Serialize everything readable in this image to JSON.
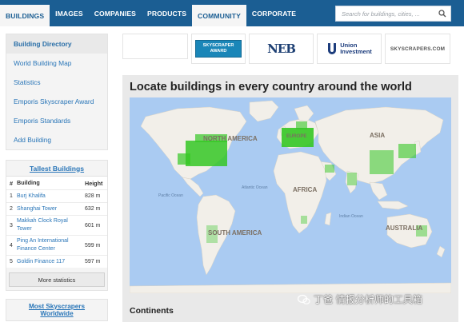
{
  "nav": {
    "items": [
      {
        "label": "BUILDINGS",
        "active": true
      },
      {
        "label": "IMAGES",
        "active": false
      },
      {
        "label": "COMPANIES",
        "active": false
      },
      {
        "label": "PRODUCTS",
        "active": false
      },
      {
        "label": "COMMUNITY",
        "active": true
      },
      {
        "label": "CORPORATE",
        "active": false
      }
    ],
    "search_placeholder": "Search for buildings, cities, ...",
    "search_icon": "search-icon"
  },
  "sidebar": {
    "items": [
      {
        "label": "Building Directory",
        "active": true
      },
      {
        "label": "World Building Map",
        "active": false
      },
      {
        "label": "Statistics",
        "active": false
      },
      {
        "label": "Emporis Skyscraper Award",
        "active": false
      },
      {
        "label": "Emporis Standards",
        "active": false
      },
      {
        "label": "Add Building",
        "active": false
      }
    ]
  },
  "tallest": {
    "title": "Tallest Buildings",
    "headers": {
      "num": "#",
      "building": "Building",
      "height": "Height"
    },
    "rows": [
      {
        "num": "1",
        "building": "Burj Khalifa",
        "height": "828 m"
      },
      {
        "num": "2",
        "building": "Shanghai Tower",
        "height": "632 m"
      },
      {
        "num": "3",
        "building": "Makkah Clock Royal Tower",
        "height": "601 m"
      },
      {
        "num": "4",
        "building": "Ping An International Finance Center",
        "height": "599 m"
      },
      {
        "num": "5",
        "building": "Goldin Finance 117",
        "height": "597 m"
      }
    ],
    "more_label": "More statistics"
  },
  "most": {
    "line1": "Most Skyscrapers",
    "line2": "Worldwide"
  },
  "logos": {
    "award_line1": "SKYSCRAPER",
    "award_line2": "AWARD",
    "neb": "NEB",
    "union_line1": "Union",
    "union_line2": "Investment",
    "sky": "SKYSCRAPERS.COM"
  },
  "main": {
    "title": "Locate buildings in every country around the world",
    "continents_heading": "Continents"
  },
  "map": {
    "labels": {
      "north_america": "NORTH AMERICA",
      "south_america": "SOUTH AMERICA",
      "africa": "AFRICA",
      "asia": "ASIA",
      "australia": "AUSTRALIA",
      "europe": "EUROPE",
      "pacific": "Pacific Ocean",
      "atlantic": "Atlantic Ocean",
      "indian": "Indian Ocean"
    },
    "colors": {
      "water": "#aacbf2",
      "land": "#f2efe9",
      "marker": "#35c724"
    }
  },
  "watermark": {
    "text": "丁爸 情报分析师的工具箱"
  }
}
